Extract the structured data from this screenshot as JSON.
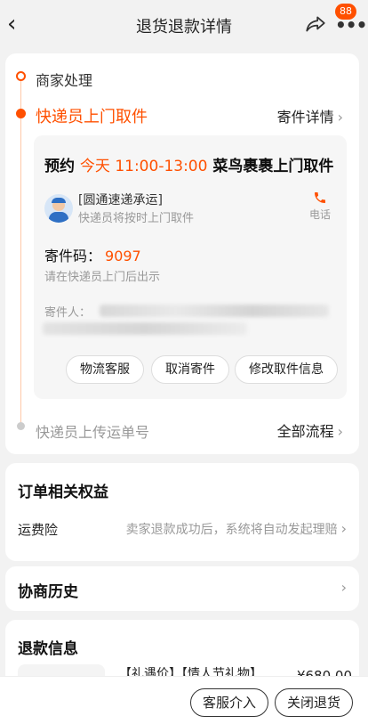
{
  "header": {
    "title": "退货退款详情",
    "back_icon": "chevron-left-icon",
    "share_icon": "share-icon",
    "more_icon": "more-icon",
    "badge": "88"
  },
  "progress": {
    "step1": "商家处理",
    "step2": "快递员上门取件",
    "detail_link": "寄件详情",
    "appointment": {
      "prefix": "预约",
      "time": "今天 11:00-13:00",
      "service": "菜鸟裹裹上门取件"
    },
    "courier": {
      "name": "[圆通速递承运]",
      "tip": "快递员将按时上门取件",
      "phone_label": "电话"
    },
    "pickup_code": {
      "label": "寄件码：",
      "value": "9097",
      "tip": "请在快递员上门后出示"
    },
    "sender_label": "寄件人：",
    "buttons": [
      "物流客服",
      "取消寄件",
      "修改取件信息"
    ],
    "step3": "快递员上传运单号",
    "all_flow": "全部流程"
  },
  "rights": {
    "title": "订单相关权益",
    "item_label": "运费险",
    "item_value": "卖家退款成功后，系统将自动发起理赔"
  },
  "history": {
    "title": "协商历史"
  },
  "refund": {
    "title": "退款信息",
    "product": "【礼遇价】【情人节礼物】",
    "price": "¥680.00"
  },
  "bottom": {
    "service_button": "客服介入",
    "close_button": "关闭退货"
  },
  "colors": {
    "accent": "#ff5000",
    "muted": "#999999"
  }
}
